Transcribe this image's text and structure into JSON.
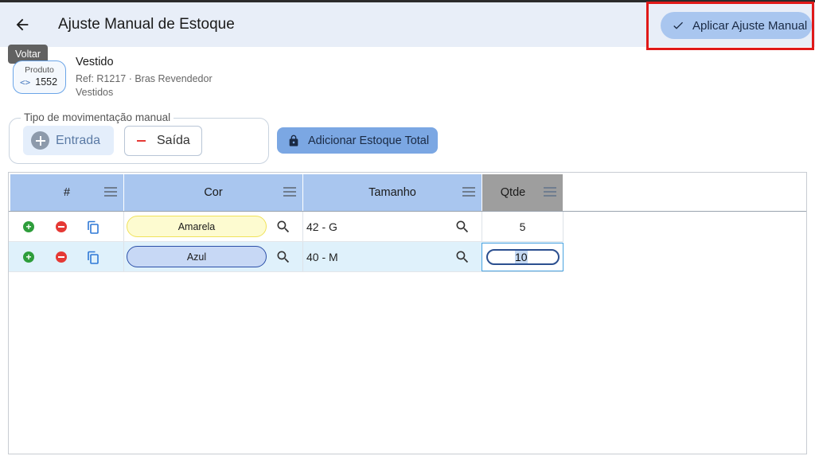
{
  "header": {
    "title": "Ajuste Manual de Estoque",
    "apply_label": "Aplicar Ajuste Manual",
    "back_tooltip": "Voltar"
  },
  "product": {
    "chip_label": "Produto",
    "code": "1552",
    "name": "Vestido",
    "ref": "Ref: R1217 · Bras Revendedor",
    "category": "Vestidos"
  },
  "movement": {
    "legend": "Tipo de movimentação manual",
    "entrada_label": "Entrada",
    "saida_label": "Saída",
    "total_label": "Adicionar Estoque Total"
  },
  "grid": {
    "columns": [
      "#",
      "Cor",
      "Tamanho",
      "Qtde"
    ],
    "rows": [
      {
        "cor": "Amarela",
        "tamanho": "42 - G",
        "qtde": "5"
      },
      {
        "cor": "Azul",
        "tamanho": "40 - M",
        "qtde": "10"
      }
    ]
  },
  "colors": {
    "header_bg": "#e8eef8",
    "accent": "#a9c6ef",
    "highlight": "#e01919",
    "pill_yellow": "#fdfbd0",
    "pill_blue": "#c7d8f5"
  },
  "icons": [
    "arrow-left-icon",
    "check-icon",
    "code-icon",
    "plus-circle-icon",
    "minus-icon",
    "lock-icon",
    "menu-icon",
    "add-circle-icon",
    "remove-circle-icon",
    "copy-icon",
    "search-icon"
  ]
}
